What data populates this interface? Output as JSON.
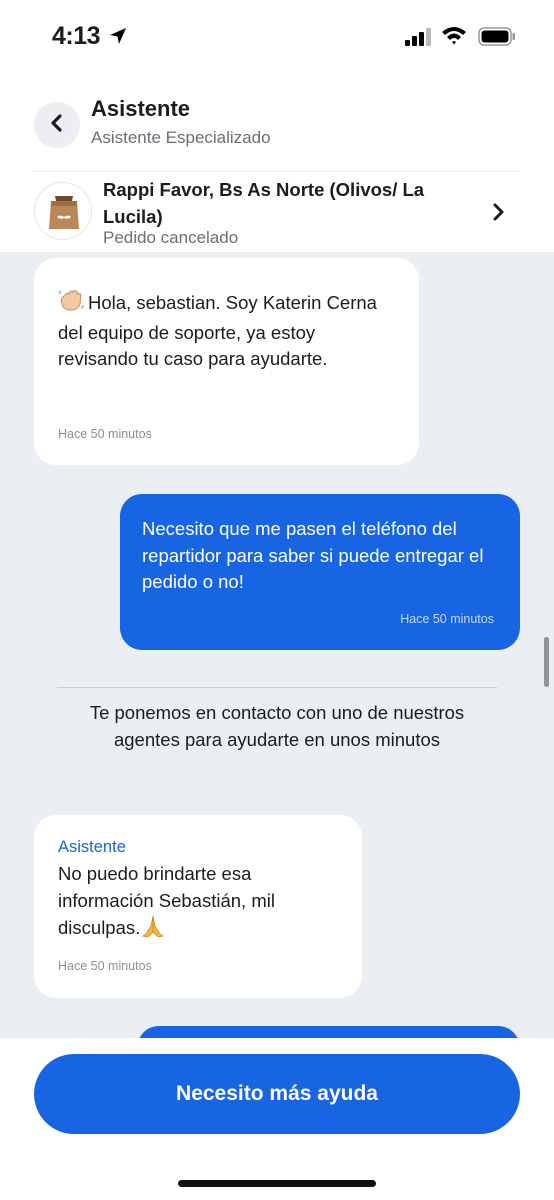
{
  "status_bar": {
    "time": "4:13"
  },
  "header": {
    "title": "Asistente",
    "subtitle": "Asistente Especializado"
  },
  "order": {
    "name": "Rappi Favor, Bs As Norte (Olivos/ La Lucila)",
    "status": "Pedido cancelado"
  },
  "messages": [
    {
      "direction": "incoming",
      "text": "Hola, sebastian. Soy Katerin Cerna del equipo de soporte, ya estoy revisando tu caso para ayudarte.",
      "emoji": "waving-hand",
      "time": "Hace 50 minutos"
    },
    {
      "direction": "outgoing",
      "text": "Necesito que me pasen el teléfono del repartidor para saber si puede entregar el pedido o no!",
      "time": "Hace 50 minutos"
    },
    {
      "direction": "system",
      "text": "Te ponemos en contacto con uno de nuestros agentes para ayudarte en unos minutos"
    },
    {
      "direction": "incoming",
      "sender": "Asistente",
      "text": "No puedo brindarte esa información Sebastián, mil disculpas.",
      "emoji": "folded-hands",
      "time": "Hace 50 minutos"
    }
  ],
  "cta": {
    "label": "Necesito más ayuda"
  },
  "colors": {
    "accent": "#1765e3",
    "chat_background": "#ebeef3",
    "incoming_bubble": "#ffffff",
    "outgoing_bubble": "#1765e3"
  }
}
